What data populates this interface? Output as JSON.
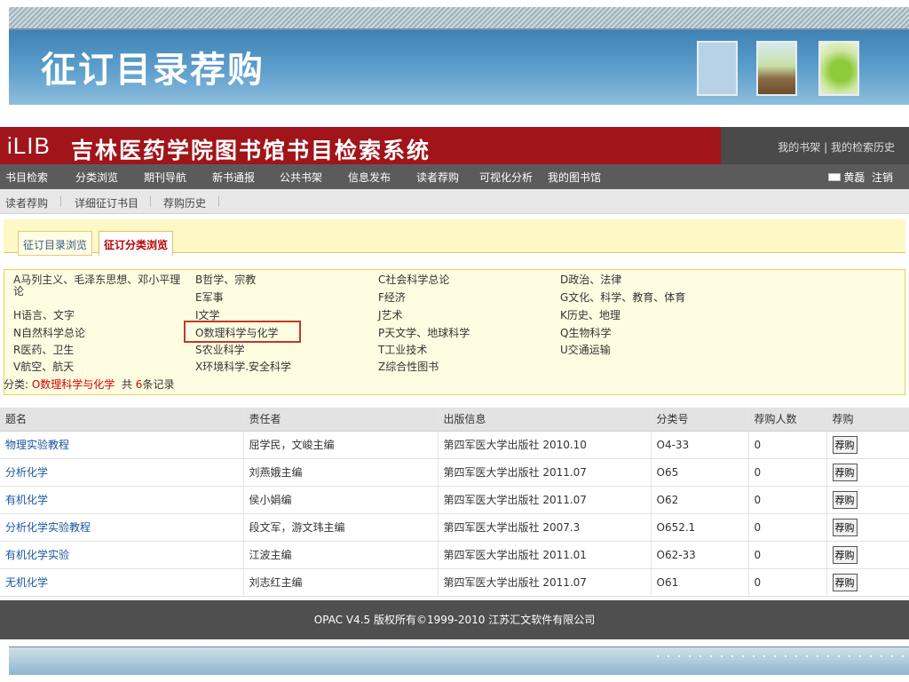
{
  "slide": {
    "title": "征订目录荐购"
  },
  "app": {
    "logo": "iLIB",
    "title": "吉林医药学院图书馆书目检索系统",
    "header_links": {
      "my_shelf": "我的书架",
      "separator": "|",
      "search_history": "我的检索历史"
    }
  },
  "nav": {
    "items": [
      "书目检索",
      "分类浏览",
      "期刊导航",
      "新书通报",
      "公共书架",
      "信息发布",
      "读者荐购",
      "可视化分析",
      "我的图书馆"
    ],
    "user": "黄磊",
    "logout": "注销"
  },
  "subnav": {
    "items": [
      "读者荐购",
      "详细征订书目",
      "荐购历史"
    ]
  },
  "tabs": [
    "征订目录浏览",
    "征订分类浏览"
  ],
  "categories": [
    {
      "label": "A马列主义、毛泽东思想、邓小平理论"
    },
    {
      "label": "B哲学、宗教"
    },
    {
      "label": "C社会科学总论"
    },
    {
      "label": "D政治、法律"
    },
    {
      "label": "E军事"
    },
    {
      "label": "F经济"
    },
    {
      "label": "G文化、科学、教育、体育"
    },
    {
      "label": "H语言、文字"
    },
    {
      "label": "I文学"
    },
    {
      "label": "J艺术"
    },
    {
      "label": "K历史、地理"
    },
    {
      "label": "N自然科学总论"
    },
    {
      "label": "O数理科学与化学",
      "selected": true
    },
    {
      "label": "P天文学、地球科学"
    },
    {
      "label": "Q生物科学"
    },
    {
      "label": "R医药、卫生"
    },
    {
      "label": "S农业科学"
    },
    {
      "label": "T工业技术"
    },
    {
      "label": "U交通运输"
    },
    {
      "label": "V航空、航天"
    },
    {
      "label": "X环境科学.安全科学"
    },
    {
      "label": "Z综合性图书"
    }
  ],
  "summary": {
    "prefix": "分类: ",
    "category": "O数理科学与化学",
    "count_prefix": "共",
    "count": "6",
    "count_suffix": "条记录"
  },
  "table": {
    "columns": [
      "题名",
      "责任者",
      "出版信息",
      "分类号",
      "荐购人数",
      "荐购"
    ],
    "rows": [
      {
        "title": "物理实验教程",
        "author": "屈学民，文峻主编",
        "pub": "第四军医大学出版社 2010.10",
        "class_no": "O4-33",
        "count": "0",
        "action": "荐购"
      },
      {
        "title": "分析化学",
        "author": "刘燕娥主编",
        "pub": "第四军医大学出版社 2011.07",
        "class_no": "O65",
        "count": "0",
        "action": "荐购"
      },
      {
        "title": "有机化学",
        "author": "侯小娟编",
        "pub": "第四军医大学出版社 2011.07",
        "class_no": "O62",
        "count": "0",
        "action": "荐购"
      },
      {
        "title": "分析化学实验教程",
        "author": "段文军，游文玮主编",
        "pub": "第四军医大学出版社 2007.3",
        "class_no": "O652.1",
        "count": "0",
        "action": "荐购"
      },
      {
        "title": "有机化学实验",
        "author": "江波主编",
        "pub": "第四军医大学出版社 2011.01",
        "class_no": "O62-33",
        "count": "0",
        "action": "荐购"
      },
      {
        "title": "无机化学",
        "author": "刘志红主编",
        "pub": "第四军医大学出版社 2011.07",
        "class_no": "O61",
        "count": "0",
        "action": "荐购"
      }
    ]
  },
  "footer": {
    "text": "OPAC V4.5   版权所有©1999-2010 江苏汇文软件有限公司"
  }
}
